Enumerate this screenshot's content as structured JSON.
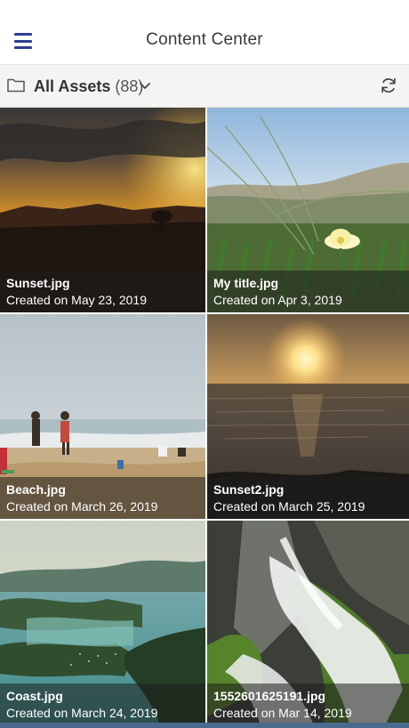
{
  "header": {
    "title": "Content Center",
    "menu_icon": "menu-icon"
  },
  "toolbar": {
    "folder_icon": "folder-icon",
    "assets_name": "All Assets",
    "assets_count": "(88)",
    "refresh_icon": "refresh-icon"
  },
  "assets": [
    {
      "file": "Sunset.jpg",
      "date": "Created on May 23, 2019"
    },
    {
      "file": "My title.jpg",
      "date": "Created on Apr 3, 2019"
    },
    {
      "file": "Beach.jpg",
      "date": "Created on March 26, 2019"
    },
    {
      "file": "Sunset2.jpg",
      "date": "Created on March 25, 2019"
    },
    {
      "file": "Coast.jpg",
      "date": "Created on March 24, 2019"
    },
    {
      "file": "1552601625191.jpg",
      "date": "Created on Mar 14, 2019"
    }
  ],
  "colors": {
    "accent": "#2f3d8f",
    "caption_overlay": "rgba(30,30,30,0.55)"
  }
}
